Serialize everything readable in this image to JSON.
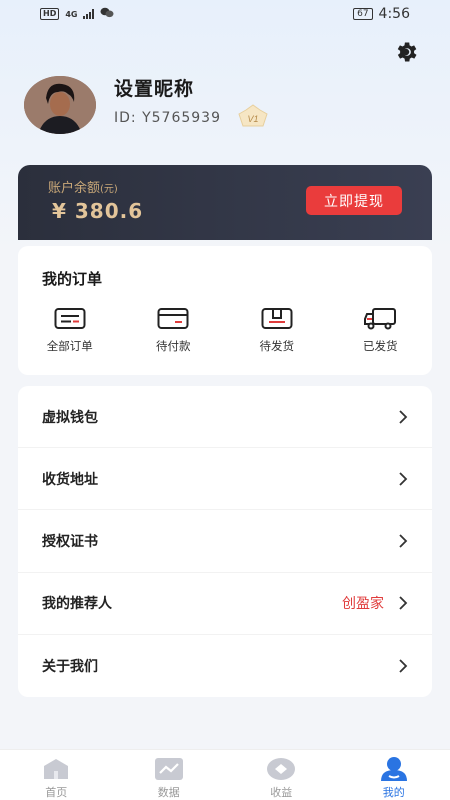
{
  "status_bar": {
    "hd": "HD",
    "network": "4G",
    "battery": "67",
    "time": "4:56"
  },
  "profile": {
    "nickname": "设置昵称",
    "user_id": "ID:  Y5765939",
    "vip_level": "V1"
  },
  "balance": {
    "label": "账户余额",
    "label_unit": "(元)",
    "amount": "¥ 380.6",
    "withdraw_label": "立即提现"
  },
  "orders": {
    "title": "我的订单",
    "items": [
      {
        "label": "全部订单",
        "icon": "order-list-icon"
      },
      {
        "label": "待付款",
        "icon": "wallet-icon"
      },
      {
        "label": "待发货",
        "icon": "box-icon"
      },
      {
        "label": "已发货",
        "icon": "truck-icon"
      }
    ]
  },
  "menu": [
    {
      "label": "虚拟钱包",
      "value": ""
    },
    {
      "label": "收货地址",
      "value": ""
    },
    {
      "label": "授权证书",
      "value": ""
    },
    {
      "label": "我的推荐人",
      "value": "创盈家"
    },
    {
      "label": "关于我们",
      "value": ""
    }
  ],
  "nav": [
    {
      "label": "首页",
      "icon": "home-icon",
      "active": false
    },
    {
      "label": "数据",
      "icon": "chart-icon",
      "active": false
    },
    {
      "label": "收益",
      "icon": "earnings-icon",
      "active": false
    },
    {
      "label": "我的",
      "icon": "profile-icon",
      "active": true
    }
  ],
  "colors": {
    "accent": "#ea3c3c",
    "active_nav": "#2a74e2",
    "gold_text": "#e3c59a"
  }
}
